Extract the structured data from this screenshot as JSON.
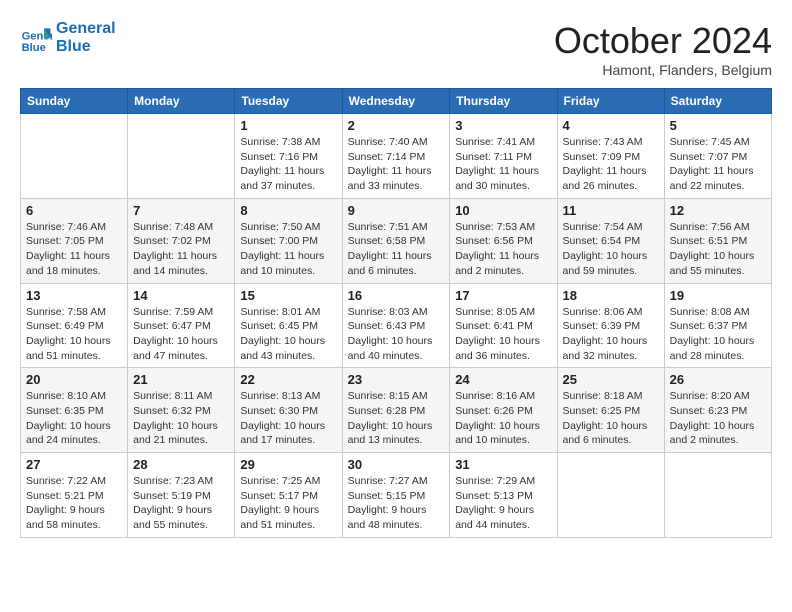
{
  "header": {
    "logo_line1": "General",
    "logo_line2": "Blue",
    "month": "October 2024",
    "location": "Hamont, Flanders, Belgium"
  },
  "weekdays": [
    "Sunday",
    "Monday",
    "Tuesday",
    "Wednesday",
    "Thursday",
    "Friday",
    "Saturday"
  ],
  "weeks": [
    [
      {
        "day": "",
        "info": ""
      },
      {
        "day": "",
        "info": ""
      },
      {
        "day": "1",
        "info": "Sunrise: 7:38 AM\nSunset: 7:16 PM\nDaylight: 11 hours\nand 37 minutes."
      },
      {
        "day": "2",
        "info": "Sunrise: 7:40 AM\nSunset: 7:14 PM\nDaylight: 11 hours\nand 33 minutes."
      },
      {
        "day": "3",
        "info": "Sunrise: 7:41 AM\nSunset: 7:11 PM\nDaylight: 11 hours\nand 30 minutes."
      },
      {
        "day": "4",
        "info": "Sunrise: 7:43 AM\nSunset: 7:09 PM\nDaylight: 11 hours\nand 26 minutes."
      },
      {
        "day": "5",
        "info": "Sunrise: 7:45 AM\nSunset: 7:07 PM\nDaylight: 11 hours\nand 22 minutes."
      }
    ],
    [
      {
        "day": "6",
        "info": "Sunrise: 7:46 AM\nSunset: 7:05 PM\nDaylight: 11 hours\nand 18 minutes."
      },
      {
        "day": "7",
        "info": "Sunrise: 7:48 AM\nSunset: 7:02 PM\nDaylight: 11 hours\nand 14 minutes."
      },
      {
        "day": "8",
        "info": "Sunrise: 7:50 AM\nSunset: 7:00 PM\nDaylight: 11 hours\nand 10 minutes."
      },
      {
        "day": "9",
        "info": "Sunrise: 7:51 AM\nSunset: 6:58 PM\nDaylight: 11 hours\nand 6 minutes."
      },
      {
        "day": "10",
        "info": "Sunrise: 7:53 AM\nSunset: 6:56 PM\nDaylight: 11 hours\nand 2 minutes."
      },
      {
        "day": "11",
        "info": "Sunrise: 7:54 AM\nSunset: 6:54 PM\nDaylight: 10 hours\nand 59 minutes."
      },
      {
        "day": "12",
        "info": "Sunrise: 7:56 AM\nSunset: 6:51 PM\nDaylight: 10 hours\nand 55 minutes."
      }
    ],
    [
      {
        "day": "13",
        "info": "Sunrise: 7:58 AM\nSunset: 6:49 PM\nDaylight: 10 hours\nand 51 minutes."
      },
      {
        "day": "14",
        "info": "Sunrise: 7:59 AM\nSunset: 6:47 PM\nDaylight: 10 hours\nand 47 minutes."
      },
      {
        "day": "15",
        "info": "Sunrise: 8:01 AM\nSunset: 6:45 PM\nDaylight: 10 hours\nand 43 minutes."
      },
      {
        "day": "16",
        "info": "Sunrise: 8:03 AM\nSunset: 6:43 PM\nDaylight: 10 hours\nand 40 minutes."
      },
      {
        "day": "17",
        "info": "Sunrise: 8:05 AM\nSunset: 6:41 PM\nDaylight: 10 hours\nand 36 minutes."
      },
      {
        "day": "18",
        "info": "Sunrise: 8:06 AM\nSunset: 6:39 PM\nDaylight: 10 hours\nand 32 minutes."
      },
      {
        "day": "19",
        "info": "Sunrise: 8:08 AM\nSunset: 6:37 PM\nDaylight: 10 hours\nand 28 minutes."
      }
    ],
    [
      {
        "day": "20",
        "info": "Sunrise: 8:10 AM\nSunset: 6:35 PM\nDaylight: 10 hours\nand 24 minutes."
      },
      {
        "day": "21",
        "info": "Sunrise: 8:11 AM\nSunset: 6:32 PM\nDaylight: 10 hours\nand 21 minutes."
      },
      {
        "day": "22",
        "info": "Sunrise: 8:13 AM\nSunset: 6:30 PM\nDaylight: 10 hours\nand 17 minutes."
      },
      {
        "day": "23",
        "info": "Sunrise: 8:15 AM\nSunset: 6:28 PM\nDaylight: 10 hours\nand 13 minutes."
      },
      {
        "day": "24",
        "info": "Sunrise: 8:16 AM\nSunset: 6:26 PM\nDaylight: 10 hours\nand 10 minutes."
      },
      {
        "day": "25",
        "info": "Sunrise: 8:18 AM\nSunset: 6:25 PM\nDaylight: 10 hours\nand 6 minutes."
      },
      {
        "day": "26",
        "info": "Sunrise: 8:20 AM\nSunset: 6:23 PM\nDaylight: 10 hours\nand 2 minutes."
      }
    ],
    [
      {
        "day": "27",
        "info": "Sunrise: 7:22 AM\nSunset: 5:21 PM\nDaylight: 9 hours\nand 58 minutes."
      },
      {
        "day": "28",
        "info": "Sunrise: 7:23 AM\nSunset: 5:19 PM\nDaylight: 9 hours\nand 55 minutes."
      },
      {
        "day": "29",
        "info": "Sunrise: 7:25 AM\nSunset: 5:17 PM\nDaylight: 9 hours\nand 51 minutes."
      },
      {
        "day": "30",
        "info": "Sunrise: 7:27 AM\nSunset: 5:15 PM\nDaylight: 9 hours\nand 48 minutes."
      },
      {
        "day": "31",
        "info": "Sunrise: 7:29 AM\nSunset: 5:13 PM\nDaylight: 9 hours\nand 44 minutes."
      },
      {
        "day": "",
        "info": ""
      },
      {
        "day": "",
        "info": ""
      }
    ]
  ]
}
